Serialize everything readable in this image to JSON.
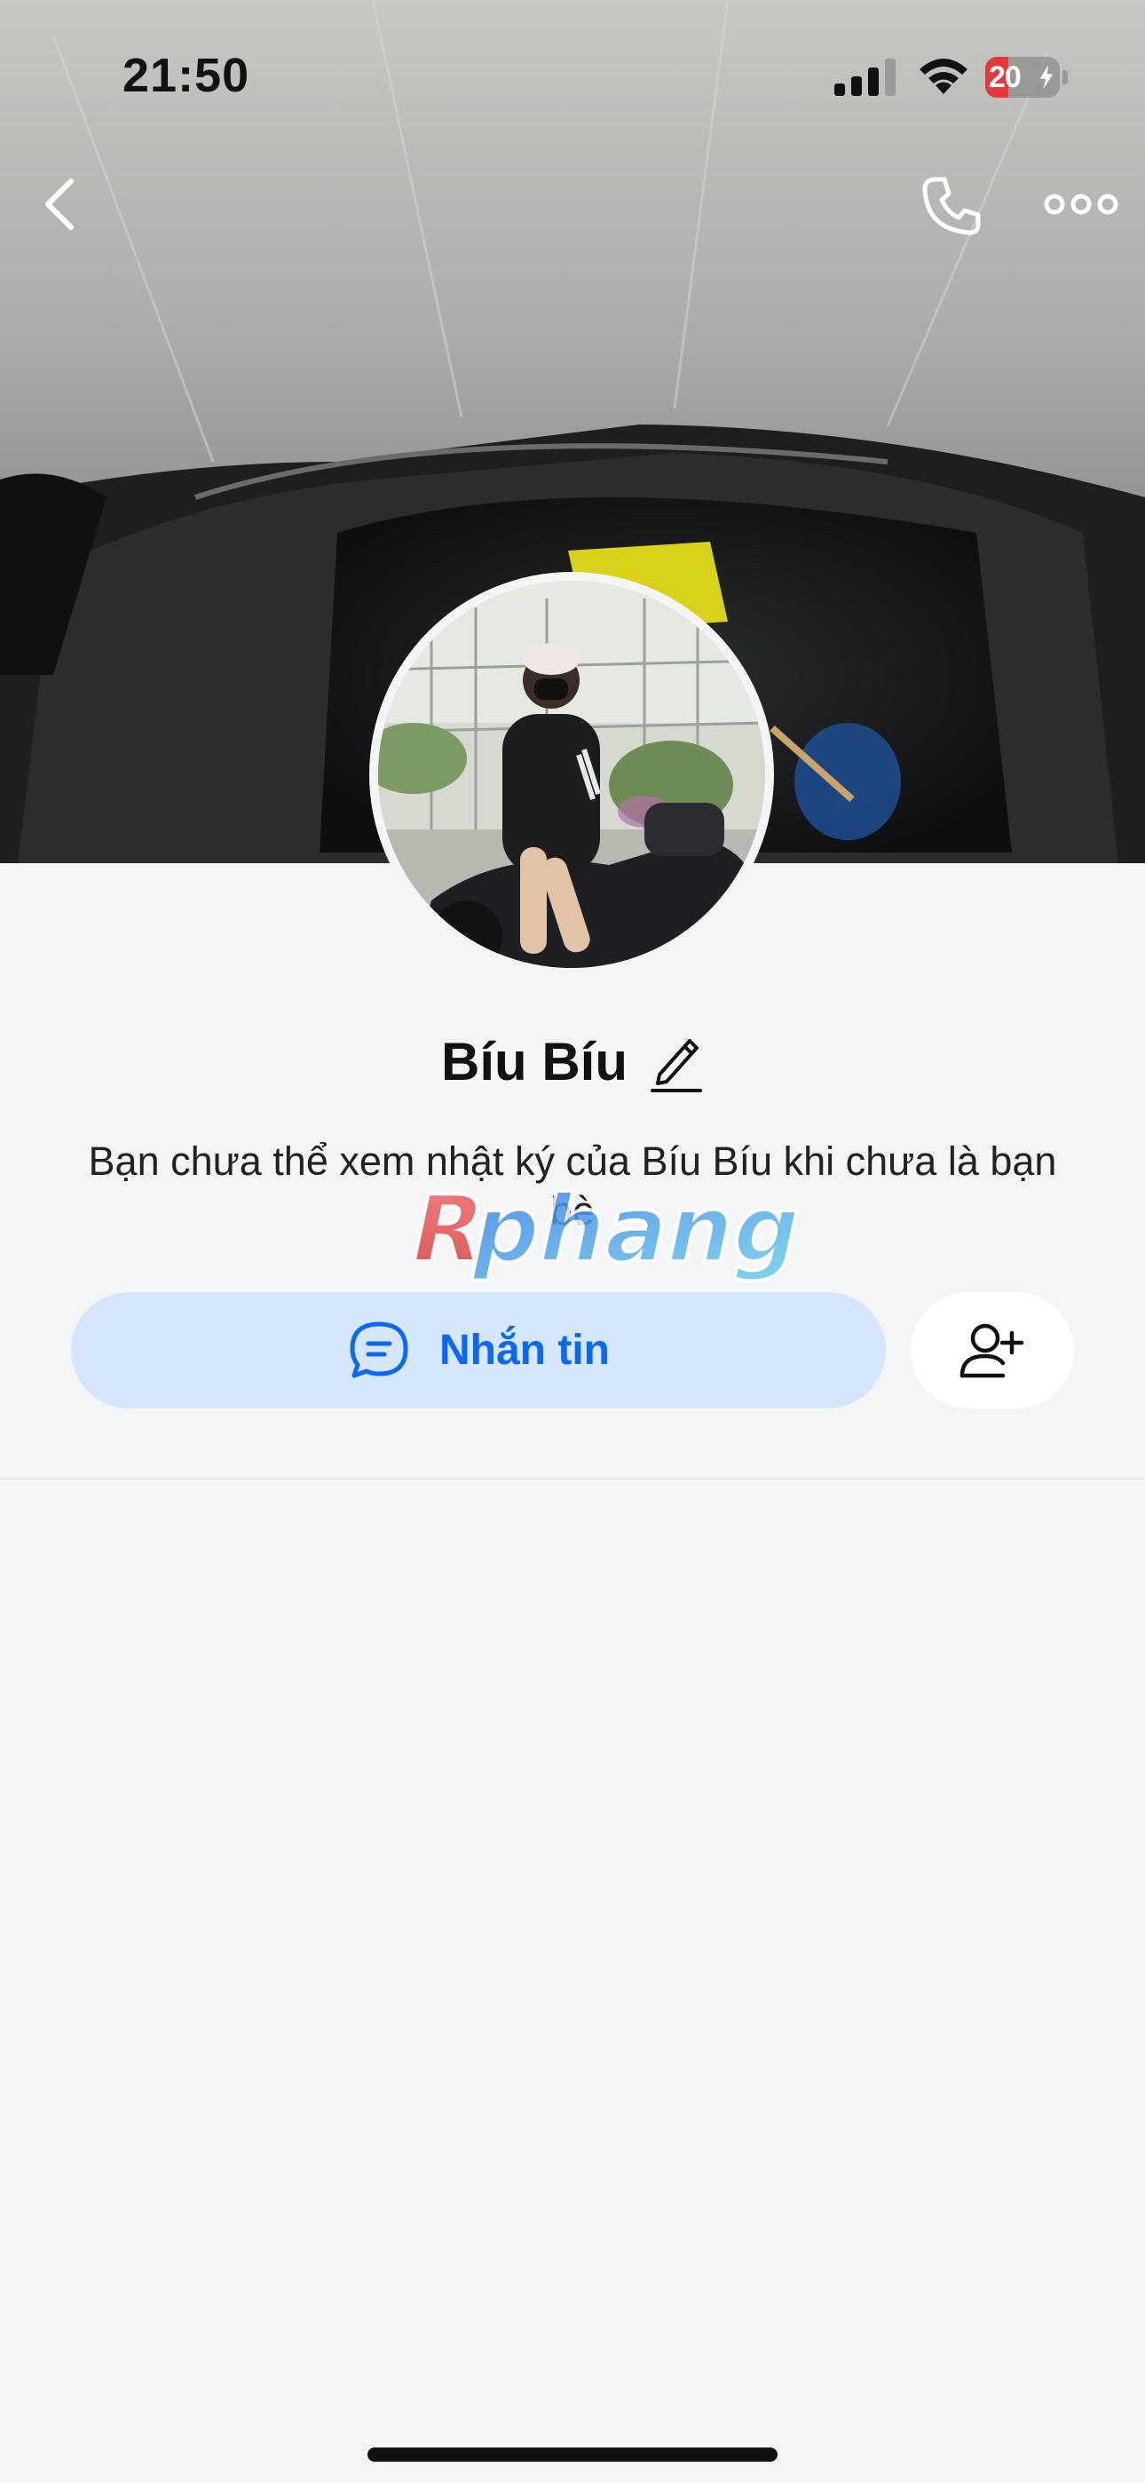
{
  "status_bar": {
    "time": "21:50",
    "battery_level": "20",
    "signal_icon": "cellular-signal-icon",
    "wifi_icon": "wifi-icon",
    "battery_icon": "battery-charging-icon"
  },
  "nav": {
    "back_icon": "chevron-left-icon",
    "call_icon": "phone-icon",
    "more_icon": "more-horizontal-icon"
  },
  "profile": {
    "name": "Bíu Bíu",
    "edit_icon": "pencil-icon",
    "notice": "Bạn chưa thể xem nhật ký của Bíu Bíu khi chưa là bạn bè"
  },
  "watermark": {
    "text": "Rphang"
  },
  "actions": {
    "message_label": "Nhắn tin",
    "message_icon": "chat-bubble-icon",
    "add_friend_icon": "add-user-icon"
  },
  "colors": {
    "accent": "#0a68f5",
    "message_button_bg": "#d5e6fd",
    "page_bg": "#f4f5f7",
    "battery_low": "#e8383d"
  }
}
